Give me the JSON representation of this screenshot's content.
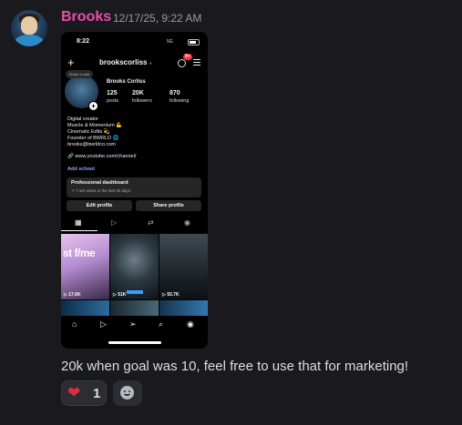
{
  "message": {
    "author": "Brooks",
    "timestamp": "12/17/25, 9:22 AM",
    "text": "20k when goal was 10, feel free to use that for marketing!",
    "reactions": [
      {
        "emoji": "heart",
        "count": "1"
      }
    ]
  },
  "phone": {
    "status": {
      "time": "8:22",
      "network": "5G"
    },
    "header": {
      "username": "brookscorliss",
      "notif_count": "9+"
    },
    "profile": {
      "note": "Share a note",
      "display_name": "Brooks Corliss",
      "stats": [
        {
          "value": "125",
          "label": "posts"
        },
        {
          "value": "20K",
          "label": "followers"
        },
        {
          "value": "870",
          "label": "following"
        }
      ],
      "bio_lines": [
        "Digital creator",
        "Muscle & Momentum 💪",
        "Cinematic Edits 💫",
        "Founder of BWRLD 🌐",
        "brooks@bwrldco.com"
      ],
      "link": "www.youtube.com/channel/",
      "add_school": "Add school"
    },
    "dashboard": {
      "title": "Professional dashboard",
      "subtitle": "7.1M views in the last 30 days."
    },
    "buttons": {
      "edit": "Edit profile",
      "share": "Share profile"
    },
    "grid_views": [
      "17.6K",
      "51K",
      "93.7K"
    ],
    "grid_overlay_text": "st f/me"
  }
}
